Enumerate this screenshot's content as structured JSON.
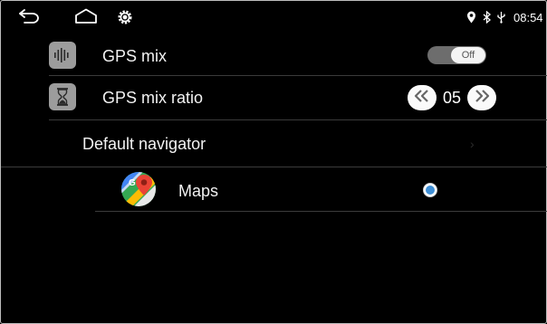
{
  "status_bar": {
    "icons": [
      "back-icon",
      "home-icon",
      "settings-icon",
      "location-icon",
      "bluetooth-icon",
      "usb-icon"
    ],
    "time": "08:54"
  },
  "settings": {
    "gps_mix": {
      "label": "GPS mix",
      "icon": "waveform-icon",
      "toggle_state": "Off"
    },
    "gps_mix_ratio": {
      "label": "GPS mix ratio",
      "icon": "hourglass-icon",
      "value": "05"
    },
    "default_navigator": {
      "label": "Default navigator"
    },
    "navigator_options": [
      {
        "label": "Maps",
        "icon": "google-maps-icon",
        "selected": true
      }
    ]
  },
  "colors": {
    "background": "#000000",
    "toggle_track": "#6d6d6d",
    "radio_selected": "#3f8fd6",
    "icon_box": "#9c9c9c",
    "divider": "#3b3b3b"
  }
}
